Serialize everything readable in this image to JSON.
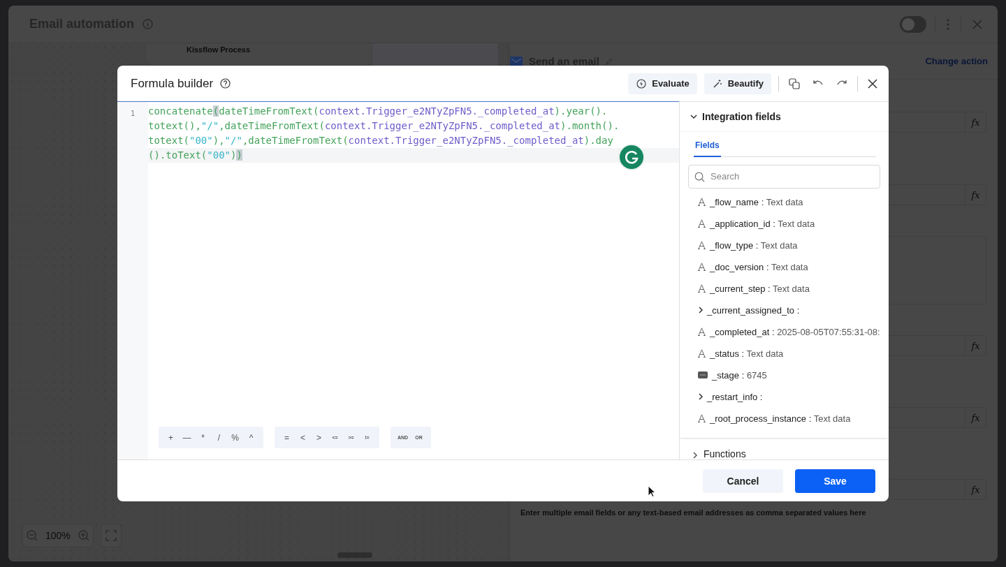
{
  "window": {
    "title": "Email automation",
    "enabled": false
  },
  "canvas": {
    "node_title": "Kissflow Process",
    "zoom": "100%"
  },
  "action_panel": {
    "title": "Send an email",
    "link": "Change action",
    "fields": [
      {
        "kind": "formula",
        "button": "fx"
      },
      {
        "kind": "formula",
        "button": "fx"
      },
      {
        "kind": "textarea"
      },
      {
        "kind": "formula",
        "button": "fx"
      },
      {
        "kind": "formula",
        "button": "fx"
      },
      {
        "kind": "formula",
        "button": "fx"
      }
    ],
    "hint": "Enter multiple email fields or any text-based email addresses as comma separated values here"
  },
  "dialog": {
    "title": "Formula builder",
    "actions": [
      "Evaluate",
      "Beautify"
    ],
    "editor": {
      "line_number": "1",
      "rows": [
        {
          "segments": [
            {
              "kind": "fn",
              "text": "concatenate"
            },
            {
              "kind": "match",
              "text": "("
            },
            {
              "kind": "fn",
              "text": "dateTimeFromText("
            },
            {
              "kind": "ref",
              "text": "context.Trigger_e2NTyZpFN5._completed_at"
            },
            {
              "kind": "fn",
              "text": ").year()."
            }
          ]
        },
        {
          "segments": [
            {
              "kind": "fn",
              "text": "totext(),"
            },
            {
              "kind": "str",
              "text": "\"/\""
            },
            {
              "kind": "fn",
              "text": ",dateTimeFromText("
            },
            {
              "kind": "ref",
              "text": "context.Trigger_e2NTyZpFN5._completed_at"
            },
            {
              "kind": "fn",
              "text": ").month()."
            }
          ]
        },
        {
          "segments": [
            {
              "kind": "fn",
              "text": "totext("
            },
            {
              "kind": "str",
              "text": "\"00\""
            },
            {
              "kind": "fn",
              "text": "),"
            },
            {
              "kind": "str",
              "text": "\"/\""
            },
            {
              "kind": "fn",
              "text": ",dateTimeFromText("
            },
            {
              "kind": "ref",
              "text": "context.Trigger_e2NTyZpFN5._completed_at"
            },
            {
              "kind": "fn",
              "text": ").day"
            }
          ]
        },
        {
          "segments": [
            {
              "kind": "fn",
              "text": "().toText("
            },
            {
              "kind": "str",
              "text": "\"00\""
            },
            {
              "kind": "fn",
              "text": ")"
            },
            {
              "kind": "match",
              "text": ")"
            }
          ]
        }
      ],
      "operator_groups": [
        [
          "+",
          "—",
          "*",
          "/",
          "%",
          "^"
        ],
        [
          "=",
          "<",
          ">",
          "<=",
          ">=",
          "!="
        ],
        [
          "AND",
          "OR"
        ]
      ]
    },
    "side": {
      "section": "Integration fields",
      "expanded": true,
      "tabs": [
        {
          "label": "Fields",
          "selected": true
        }
      ],
      "search": {
        "placeholder": "Search"
      },
      "fields": [
        {
          "kind": "text",
          "name": "_flow_name :",
          "value": "Text data"
        },
        {
          "kind": "text",
          "name": "_application_id :",
          "value": "Text data"
        },
        {
          "kind": "text",
          "name": "_flow_type :",
          "value": "Text data"
        },
        {
          "kind": "text",
          "name": "_doc_version :",
          "value": "Text data"
        },
        {
          "kind": "text",
          "name": "_current_step :",
          "value": "Text data"
        },
        {
          "kind": "group",
          "name": "_current_assigned_to :"
        },
        {
          "kind": "text",
          "name": "_completed_at :",
          "value": "2025-08-05T07:55:31-08:"
        },
        {
          "kind": "text",
          "name": "_status :",
          "value": "Text data"
        },
        {
          "kind": "number",
          "name": "_stage :",
          "value": "6745"
        },
        {
          "kind": "group",
          "name": "_restart_info :"
        },
        {
          "kind": "text",
          "name": "_root_process_instance :",
          "value": "Text data"
        }
      ],
      "next_section": "Functions"
    },
    "buttons": [
      "Cancel",
      "Save"
    ]
  }
}
